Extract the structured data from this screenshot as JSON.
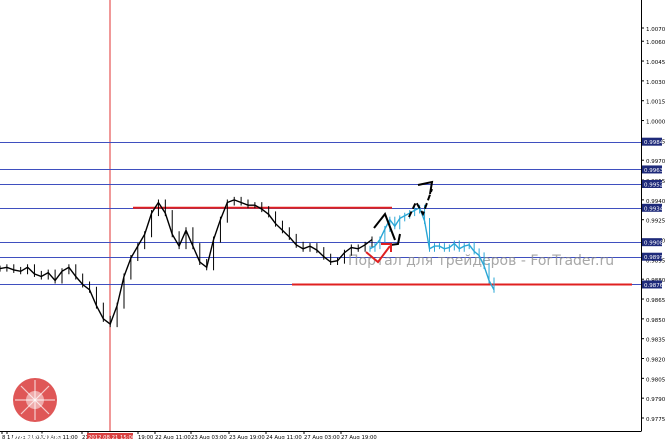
{
  "watermark": "Портал для трейдеров - ForTrader.ru",
  "logo": {
    "text": "InstaForex"
  },
  "colors": {
    "background": "#ffffff",
    "price": "#000000",
    "forecast": "#2aa7d6",
    "support_resistance": "#e02020",
    "level": "#3f4fbf",
    "vline": "#e03030",
    "axis": "#000000",
    "logo": "#d93a3a",
    "label_bg": "#1e2a7a"
  },
  "y_axis": {
    "ticks": [
      "1.0070",
      "1.0060",
      "1.0045",
      "1.0030",
      "1.0015",
      "1.0000",
      "0.9985",
      "0.9970",
      "0.9955",
      "0.9940",
      "0.9925",
      "0.9910",
      "0.9895",
      "0.9880",
      "0.9865",
      "0.9850",
      "0.9835",
      "0.9820",
      "0.9805",
      "0.9790",
      "0.9775"
    ],
    "level_labels": [
      "0.9984",
      "0.9963",
      "0.9952",
      "0.9934",
      "0.9908",
      "0.9897",
      "0.9876"
    ]
  },
  "x_axis": {
    "labels": [
      "8",
      "17 Aug 21:00",
      "19 Aug 11:00",
      "21",
      "2012.08.21 15:00",
      "19:00",
      "22 Aug 11:00",
      "23 Aug 03:00",
      "23 Aug 19:00",
      "24 Aug 11:00",
      "27 Aug 03:00",
      "27 Aug 19:00"
    ]
  },
  "chart_data": {
    "type": "line",
    "title": "",
    "xlabel": "",
    "ylabel": "",
    "ylim": [
      0.977,
      1.0078
    ],
    "horizontal_levels": [
      0.9984,
      0.9963,
      0.9952,
      0.9934,
      0.9908,
      0.9897,
      0.9876
    ],
    "red_lines": [
      {
        "name": "resistance",
        "value": 0.9934
      },
      {
        "name": "support",
        "value": 0.9876
      }
    ],
    "vertical_marker": "2012.08.21 15:00",
    "series": [
      {
        "values": [
          0.9888,
          0.9889,
          0.9887,
          0.9886,
          0.9889,
          0.9884,
          0.9882,
          0.9885,
          0.9879,
          0.9886,
          0.9889,
          0.9882,
          0.9876,
          0.9872,
          0.986,
          0.985,
          0.9846,
          0.986,
          0.9882,
          0.9896,
          0.9905,
          0.9914,
          0.993,
          0.9938,
          0.993,
          0.9914,
          0.9905,
          0.9917,
          0.9905,
          0.9893,
          0.9889,
          0.991,
          0.9925,
          0.9938,
          0.994,
          0.9938,
          0.9936,
          0.9936,
          0.9933,
          0.9929,
          0.9922,
          0.9917,
          0.9912,
          0.9906,
          0.9903,
          0.9905,
          0.9902,
          0.9897,
          0.9893,
          0.9894,
          0.99,
          0.9904,
          0.9903,
          0.9906,
          0.991
        ]
      },
      {
        "values": [
          0.9903,
          0.9905,
          0.991,
          0.9918,
          0.9925,
          0.992,
          0.9926,
          0.9928,
          0.993,
          0.9932,
          0.9934,
          0.9924,
          0.9903,
          0.9905,
          0.9905,
          0.9903,
          0.9904,
          0.9907,
          0.9903,
          0.9905,
          0.9906,
          0.9901,
          0.9898,
          0.989,
          0.9879,
          0.9872
        ]
      }
    ]
  }
}
